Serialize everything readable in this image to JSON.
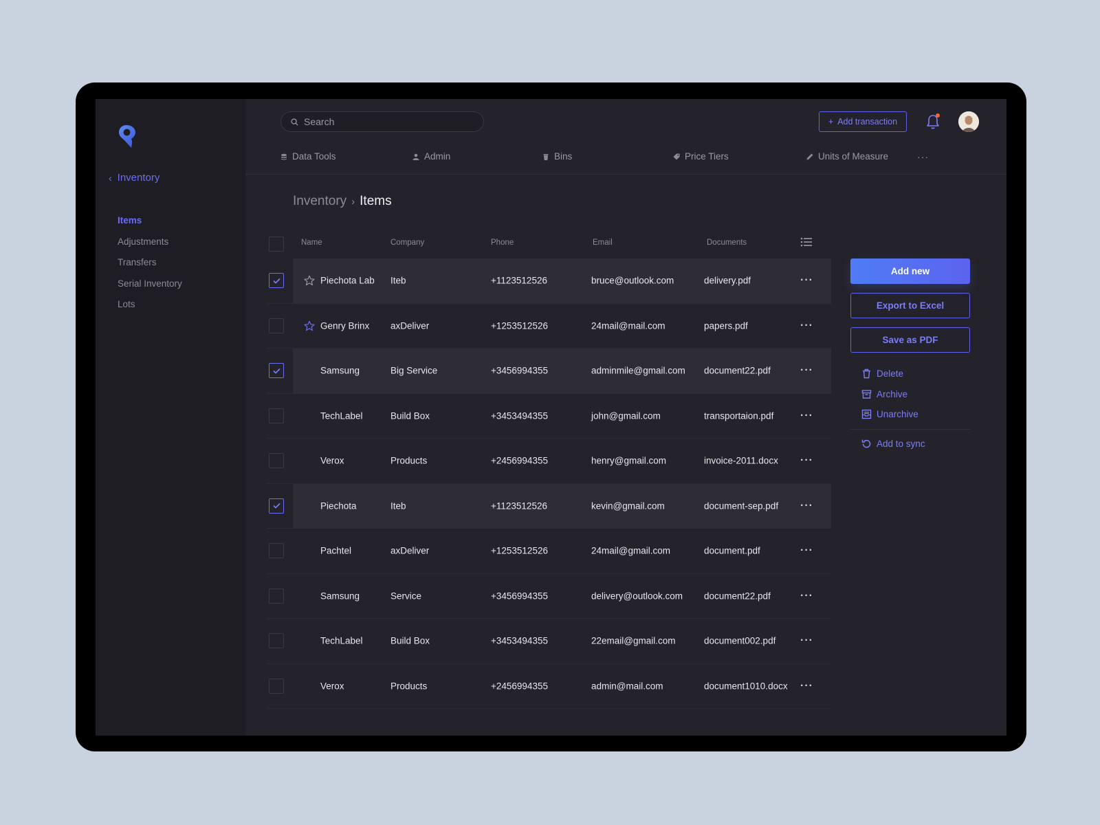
{
  "sidebar": {
    "back_label": "Inventory",
    "items": [
      {
        "label": "Items",
        "active": true
      },
      {
        "label": "Adjustments",
        "active": false
      },
      {
        "label": "Transfers",
        "active": false
      },
      {
        "label": "Serial Inventory",
        "active": false
      },
      {
        "label": "Lots",
        "active": false
      }
    ]
  },
  "header": {
    "search_placeholder": "Search",
    "add_transaction_label": "Add transaction",
    "icons": [
      "search-icon",
      "plus-icon",
      "bell-icon",
      "avatar"
    ]
  },
  "subnav": {
    "tabs": [
      {
        "label": "Data Tools",
        "icon": "database-icon"
      },
      {
        "label": "Admin",
        "icon": "user-icon"
      },
      {
        "label": "Bins",
        "icon": "bin-icon"
      },
      {
        "label": "Price Tiers",
        "icon": "tag-icon"
      },
      {
        "label": "Units of Measure",
        "icon": "pencil-icon"
      }
    ],
    "more_label": "···"
  },
  "breadcrumb": {
    "parent": "Inventory",
    "separator": "›",
    "current": "Items"
  },
  "table": {
    "columns": [
      "Name",
      "Company",
      "Phone",
      "Email",
      "Documents"
    ],
    "rows": [
      {
        "checked": true,
        "starred": true,
        "name": "Piechota Lab",
        "company": "Iteb",
        "phone": "+1123512526",
        "email": "bruce@outlook.com",
        "document": "delivery.pdf"
      },
      {
        "checked": false,
        "starred": true,
        "name": "Genry Brinx",
        "company": "axDeliver",
        "phone": "+1253512526",
        "email": "24mail@mail.com",
        "document": "papers.pdf"
      },
      {
        "checked": true,
        "starred": false,
        "name": "Samsung",
        "company": "Big Service",
        "phone": "+3456994355",
        "email": "adminmile@gmail.com",
        "document": "document22.pdf"
      },
      {
        "checked": false,
        "starred": false,
        "name": "TechLabel",
        "company": "Build Box",
        "phone": "+3453494355",
        "email": "john@gmail.com",
        "document": "transportaion.pdf"
      },
      {
        "checked": false,
        "starred": false,
        "name": "Verox",
        "company": "Products",
        "phone": "+2456994355",
        "email": "henry@gmail.com",
        "document": "invoice-2011.docx"
      },
      {
        "checked": true,
        "starred": false,
        "name": "Piechota",
        "company": "Iteb",
        "phone": "+1123512526",
        "email": "kevin@gmail.com",
        "document": "document-sep.pdf"
      },
      {
        "checked": false,
        "starred": false,
        "name": "Pachtel",
        "company": "axDeliver",
        "phone": "+1253512526",
        "email": "24mail@gmail.com",
        "document": "document.pdf"
      },
      {
        "checked": false,
        "starred": false,
        "name": "Samsung",
        "company": "Service",
        "phone": "+3456994355",
        "email": "delivery@outlook.com",
        "document": "document22.pdf"
      },
      {
        "checked": false,
        "starred": false,
        "name": "TechLabel",
        "company": "Build Box",
        "phone": "+3453494355",
        "email": "22email@gmail.com",
        "document": "document002.pdf"
      },
      {
        "checked": false,
        "starred": false,
        "name": "Verox",
        "company": "Products",
        "phone": "+2456994355",
        "email": "admin@mail.com",
        "document": "document1010.docx"
      }
    ],
    "row_menu_label": "···"
  },
  "actions": {
    "add_new": "Add new",
    "export_excel": "Export to Excel",
    "save_pdf": "Save as PDF",
    "links": [
      {
        "label": "Delete",
        "icon": "trash-icon"
      },
      {
        "label": "Archive",
        "icon": "archive-icon"
      },
      {
        "label": "Unarchive",
        "icon": "unarchive-icon"
      }
    ],
    "sync_label": "Add to sync"
  },
  "colors": {
    "accent": "#6b6ef0",
    "primary_gradient_start": "#4f7cf5",
    "primary_gradient_end": "#5c63ee",
    "notification_dot": "#f2673c",
    "background": "#24232b",
    "sidebar": "#1e1d24"
  }
}
